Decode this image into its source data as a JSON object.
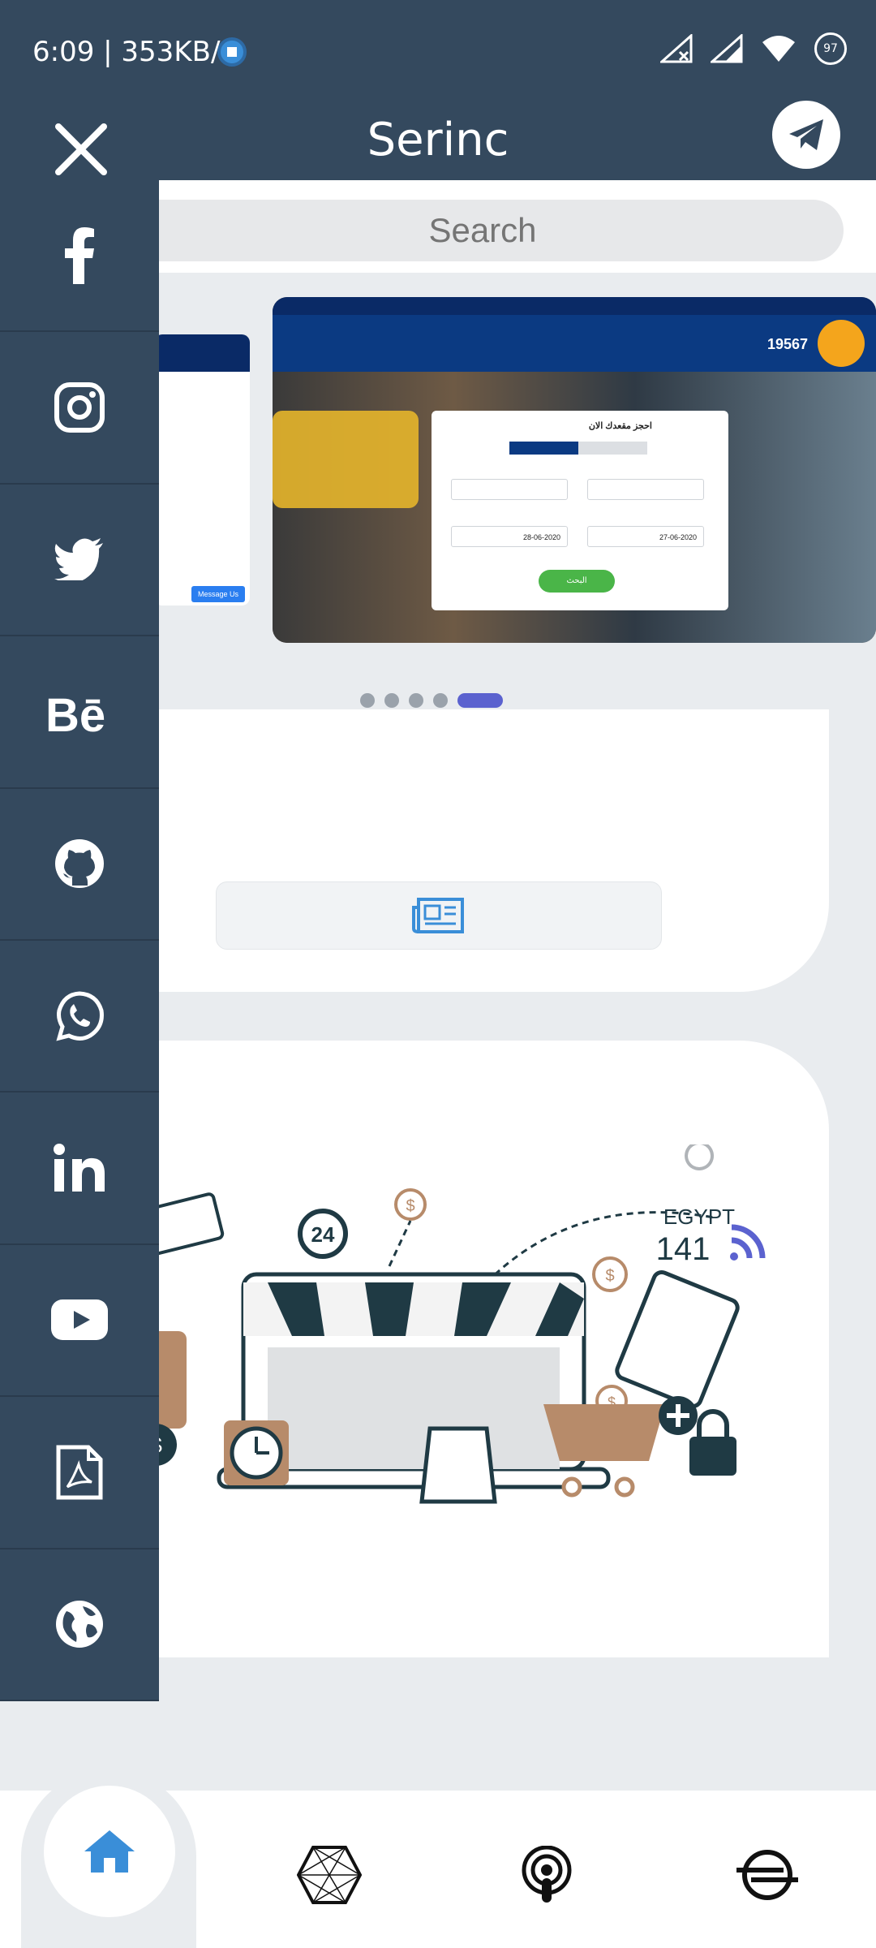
{
  "status_bar": {
    "time": "6:09 | 353KB/s",
    "battery": "97"
  },
  "app": {
    "title": "Serinc"
  },
  "search": {
    "placeholder": "Search"
  },
  "carousel": {
    "slide_count": 4,
    "active_index": 3,
    "preview": {
      "phone": "19567",
      "form_title": "احجز مقعدك الان",
      "date_depart": "27-06-2020",
      "date_return": "28-06-2020",
      "button": "البحث",
      "left_slide_button": "Message Us"
    }
  },
  "illustration": {
    "country": "EGYPT",
    "number": "141",
    "badge": "24"
  },
  "social_menu": [
    {
      "icon": "facebook-icon"
    },
    {
      "icon": "instagram-icon"
    },
    {
      "icon": "twitter-icon"
    },
    {
      "icon": "behance-icon"
    },
    {
      "icon": "github-icon"
    },
    {
      "icon": "whatsapp-icon"
    },
    {
      "icon": "linkedin-icon"
    },
    {
      "icon": "youtube-icon"
    },
    {
      "icon": "pdf-icon"
    },
    {
      "icon": "globe-icon"
    }
  ],
  "bottom_nav": [
    "home-icon",
    "hexagon-icon",
    "podcast-icon",
    "stream-icon"
  ],
  "colors": {
    "header": "#34495e",
    "accent": "#5b62cf",
    "home_blue": "#3a8ed8"
  }
}
